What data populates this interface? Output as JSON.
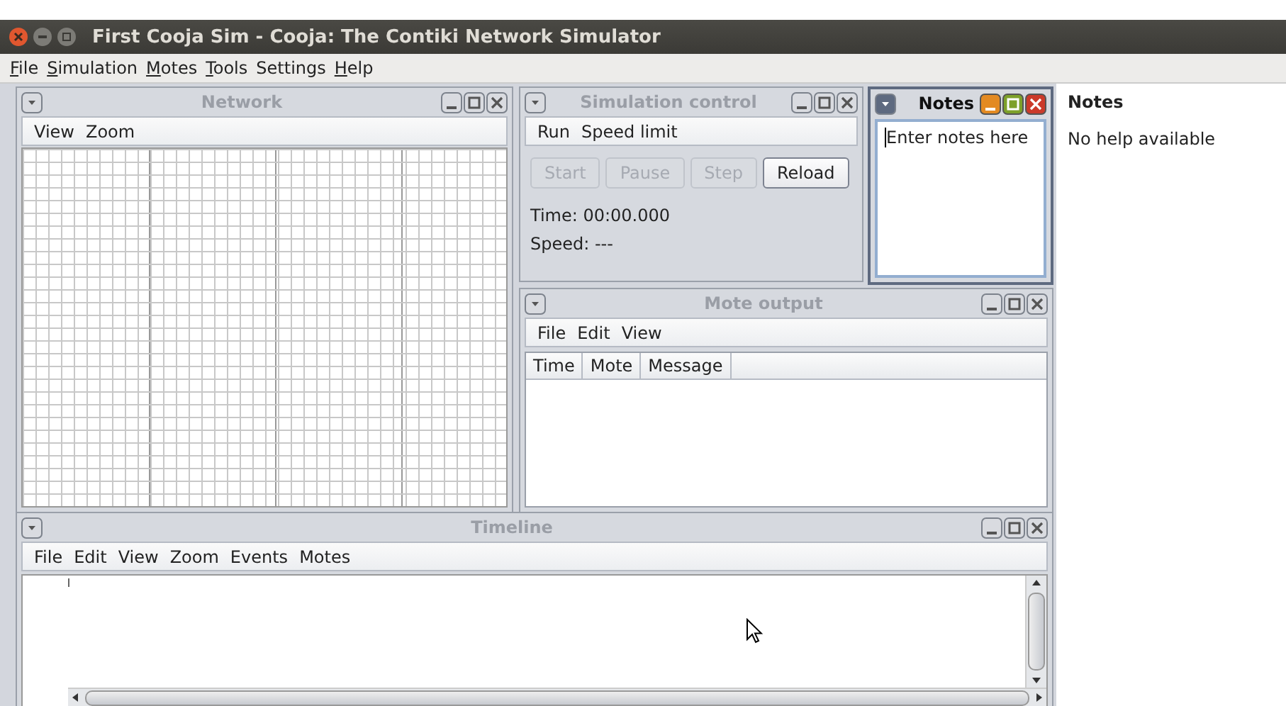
{
  "window": {
    "title": "First Cooja Sim - Cooja: The Contiki Network Simulator"
  },
  "menu_bar": [
    {
      "label": "File",
      "underlined_first": true
    },
    {
      "label": "Simulation",
      "underlined_first": true
    },
    {
      "label": "Motes",
      "underlined_first": true
    },
    {
      "label": "Tools",
      "underlined_first": true
    },
    {
      "label": "Settings",
      "underlined_first": false
    },
    {
      "label": "Help",
      "underlined_first": true
    }
  ],
  "network": {
    "title": "Network",
    "active": false,
    "menu": [
      "View",
      "Zoom"
    ]
  },
  "simulation_control": {
    "title": "Simulation control",
    "active": false,
    "menu": [
      "Run",
      "Speed limit"
    ],
    "buttons": [
      {
        "label": "Start",
        "disabled": true
      },
      {
        "label": "Pause",
        "disabled": true
      },
      {
        "label": "Step",
        "disabled": true
      },
      {
        "label": "Reload",
        "disabled": false
      }
    ],
    "time": "Time: 00:00.000",
    "speed": "Speed: ---"
  },
  "notes": {
    "title": "Notes",
    "active": true,
    "value": "Enter notes here"
  },
  "mote_output": {
    "title": "Mote output",
    "active": false,
    "menu": [
      "File",
      "Edit",
      "View"
    ],
    "columns": [
      "Time",
      "Mote",
      "Message"
    ]
  },
  "timeline": {
    "title": "Timeline",
    "active": false,
    "menu": [
      "File",
      "Edit",
      "View",
      "Zoom",
      "Events",
      "Motes"
    ]
  },
  "help_panel": {
    "title": "Notes",
    "text": "No help available"
  }
}
